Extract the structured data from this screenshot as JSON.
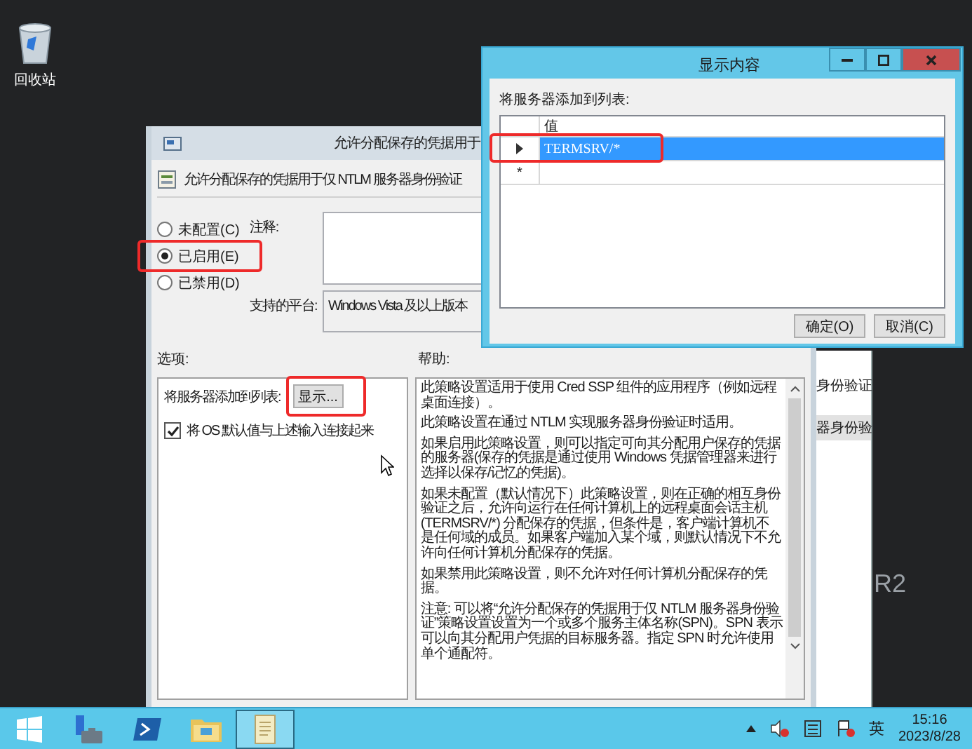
{
  "desktop": {
    "icons": [
      {
        "label": "回收站"
      }
    ],
    "edition_text": "R2"
  },
  "background_window": {
    "items": [
      {
        "text": "身份验证",
        "selected": false
      },
      {
        "text": "器身份验",
        "selected": true
      }
    ]
  },
  "policy_dialog": {
    "title": "允许分配保存的凭据用于",
    "heading": "允许分配保存的凭据用于仅 NTLM 服务器身份验证",
    "states": [
      {
        "label": "未配置(C)",
        "selected": false
      },
      {
        "label": "已启用(E)",
        "selected": true
      },
      {
        "label": "已禁用(D)",
        "selected": false
      }
    ],
    "comment_label": "注释:",
    "platform_label": "支持的平台:",
    "platform": "Windows Vista 及以上版本",
    "options_label": "选项:",
    "help_label": "帮助:",
    "options": {
      "servers_label": "将服务器添加到列表:",
      "show_button": "显示...",
      "checkbox": {
        "label": "将 OS 默认值与上述输入连接起来",
        "checked": true
      }
    },
    "help_paragraphs": [
      "此策略设置适用于使用 Cred SSP 组件的应用程序（例如远程桌面连接）。",
      "此策略设置在通过 NTLM 实现服务器身份验证时适用。",
      "如果启用此策略设置，则可以指定可向其分配用户保存的凭据的服务器(保存的凭据是通过使用 Windows 凭据管理器来进行选择以保存/记忆的凭据)。",
      "如果未配置（默认情况下）此策略设置，则在正确的相互身份验证之后，允许向运行在任何计算机上的远程桌面会话主机 (TERMSRV/*) 分配保存的凭据，但条件是，客户端计算机不是任何域的成员。如果客户端加入某个域，则默认情况下不允许向任何计算机分配保存的凭据。",
      "如果禁用此策略设置，则不允许对任何计算机分配保存的凭据。",
      "注意: 可以将“允许分配保存的凭据用于仅 NTLM 服务器身份验证”策略设置设置为一个或多个服务主体名称(SPN)。SPN 表示可以向其分配用户凭据的目标服务器。指定 SPN 时允许使用单个通配符。"
    ]
  },
  "show_dialog": {
    "title": "显示内容",
    "label": "将服务器添加到列表:",
    "column": "值",
    "rows": [
      {
        "value": "TERMSRV/*",
        "selected": true
      }
    ],
    "new_row_marker": "*",
    "buttons": [
      "确定(O)",
      "取消(C)"
    ]
  },
  "taskbar": {
    "apps": [
      {
        "kind": "server-manager",
        "active": false
      },
      {
        "kind": "powershell",
        "active": false
      },
      {
        "kind": "explorer",
        "active": false
      },
      {
        "kind": "notepad",
        "active": true
      }
    ],
    "tray": {
      "ime": "英",
      "time": "15:16",
      "date": "2023/8/28"
    }
  }
}
